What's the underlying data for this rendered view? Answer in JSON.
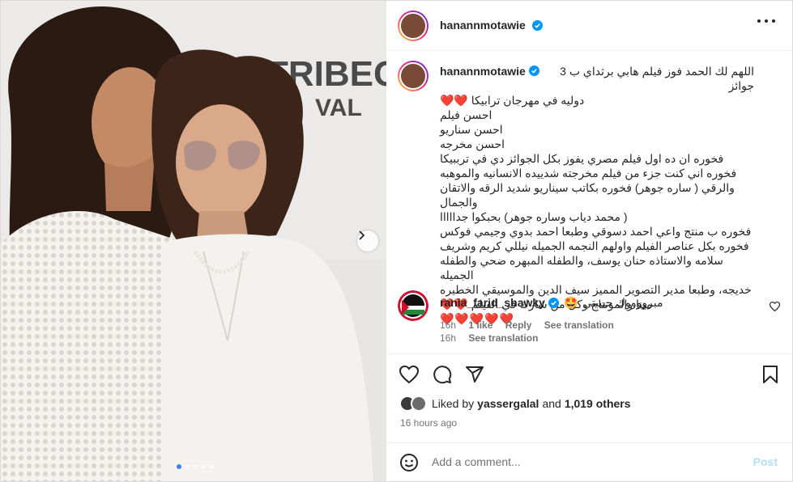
{
  "post": {
    "username": "hanannmotawie",
    "verified": true,
    "more_icon": "more-horizontal-icon",
    "caption": {
      "username": "hanannmotawie",
      "line1": "اللهم لك الحمد فوز فيلم هابي برثداي ب 3 جوائز",
      "line2": "دوليه في مهرجان ترابيكا",
      "line2_hearts": "❤️❤️",
      "line3": "احسن فيلم",
      "line4": "احسن سناريو",
      "line5": "احسن مخرجه",
      "line6": "فخوره ان ده اول فيلم مصري يفوز بكل الجوائز دي في ترببيكا",
      "line7": "فخوره اني كنت جزء من فيلم مخرجته شدييده الانسانيه والموهبه",
      "line8": "والرقي ( ساره جوهر) فخوره بكاتب سيناريو شديد الرقه والاتقان والجمال",
      "line9": "( محمد دياب وساره جوهر) بحبكوا جدااااا",
      "line10": "فخوره ب منتج واعي احمد دسوقي وطبعا احمد بدوي وجيمي فوكس",
      "line11": "فخوره بكل عناصر الفيلم واولهم النجمه الجميله نيللي كريم وشريف",
      "line12": "سلامه والاستاذه حنان يوسف، والطفله المبهره ضحي والطفله الجميله",
      "line13": "خديجه، وطبعا مدير التصوير المميز سيف الدين والموسيقي الخطيره",
      "line14": "مينا والمونتاج وكل من شارك في الفيلم",
      "line14_hearts": "❤️❤️",
      "line15_hearts": "❤️❤️❤️❤️❤️",
      "time": "16h",
      "see_translation": "See translation"
    },
    "comment": {
      "username": "rania_farid_shawky",
      "verified": true,
      "text": "مبرووووك حبيبتي",
      "emoji": "🤩",
      "time": "16h",
      "likes": "1 like",
      "reply": "Reply",
      "see_translation": "See translation",
      "like_icon": "heart-outline-icon"
    },
    "actions": {
      "like_icon": "heart-outline-icon",
      "comment_icon": "comment-bubble-icon",
      "share_icon": "paper-plane-icon",
      "save_icon": "bookmark-icon"
    },
    "likes": {
      "prefix": "Liked by",
      "user": "yassergalal",
      "middle": "and",
      "others": "1,019 others"
    },
    "time_ago": "16 hours ago",
    "add_comment": {
      "placeholder": "Add a comment...",
      "post_label": "Post"
    },
    "carousel": {
      "slides": 5,
      "active_index": 0,
      "next_icon": "chevron-right-icon"
    },
    "photo_sign": {
      "text1": "TRIBECA",
      "text2": "VAL"
    }
  },
  "colors": {
    "accent": "#0095f6",
    "muted": "#737373",
    "heart": "#e0142b",
    "post_disabled": "#b2dffc"
  }
}
